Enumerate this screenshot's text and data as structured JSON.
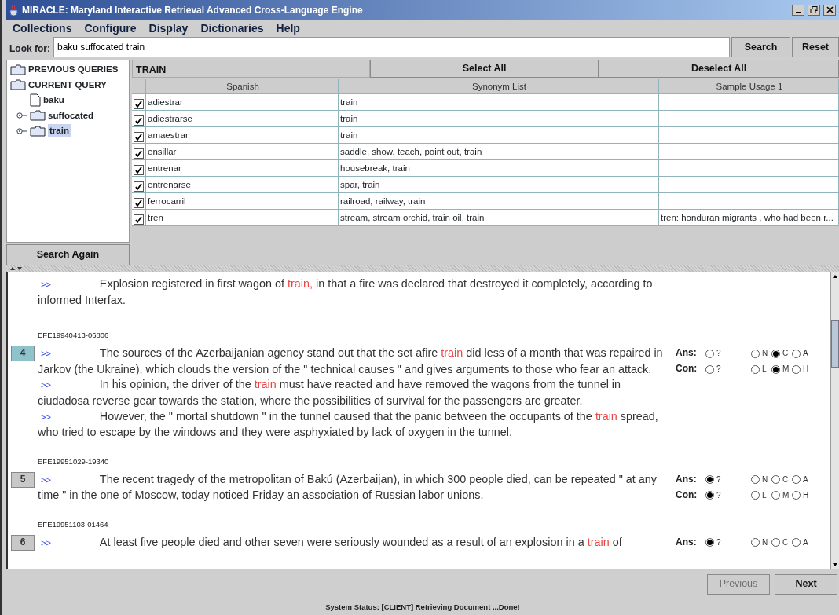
{
  "window": {
    "title": "MIRACLE: Maryland Interactive Retrieval Advanced Cross-Language Engine"
  },
  "menu": [
    "Collections",
    "Configure",
    "Display",
    "Dictionaries",
    "Help"
  ],
  "search": {
    "label": "Look for:",
    "value": "baku suffocated train",
    "buttons": [
      "Search",
      "Reset"
    ]
  },
  "tree": {
    "items": [
      {
        "label": "PREVIOUS QUERIES",
        "kind": "folder",
        "selected": false
      },
      {
        "label": "CURRENT QUERY",
        "kind": "folder",
        "selected": false,
        "children": [
          {
            "label": "baku",
            "kind": "file",
            "selected": false
          },
          {
            "label": "suffocated",
            "kind": "folder",
            "expandable": true,
            "selected": false
          },
          {
            "label": "train",
            "kind": "folder",
            "expandable": true,
            "selected": true
          }
        ]
      }
    ],
    "button": "Search Again"
  },
  "term_panel": {
    "term": "TRAIN",
    "buttons": [
      "Select All",
      "Deselect All"
    ],
    "columns": [
      "Spanish",
      "Synonym List",
      "Sample Usage 1"
    ],
    "rows": [
      {
        "checked": true,
        "spanish": "adiestrar",
        "synonyms": "train"
      },
      {
        "checked": true,
        "spanish": "adiestrarse",
        "synonyms": "train"
      },
      {
        "checked": true,
        "spanish": "amaestrar",
        "synonyms": "train"
      },
      {
        "checked": true,
        "spanish": "ensillar",
        "synonyms": "saddle, show, teach, point out, train"
      },
      {
        "checked": true,
        "spanish": "entrenar",
        "synonyms": "housebreak, train"
      },
      {
        "checked": true,
        "spanish": "entrenarse",
        "synonyms": "spar, train"
      },
      {
        "checked": true,
        "spanish": "ferrocarril",
        "synonyms": "railroad, railway, train"
      },
      {
        "checked": true,
        "spanish": "tren",
        "synonyms": "stream, stream orchid, train oil, train",
        "sample": "tren: honduran migrants , who had been r..."
      }
    ]
  },
  "results": {
    "documents": [
      {
        "paragraphs": [
          {
            "marker": ">>",
            "segments": [
              {
                "text": "Explosion registered in first wagon of ",
                "highlight": false
              },
              {
                "text": "train,",
                "highlight": true
              },
              {
                "text": " in that a fire was declared that destroyed it completely, according to informed Interfax.",
                "highlight": false
              }
            ]
          }
        ]
      },
      {
        "id": "EFE19940413-06806",
        "number": {
          "label": "4",
          "selected": true
        },
        "paragraphs": [
          {
            "marker": ">>",
            "segments": [
              {
                "text": "The sources of the Azerbaijanian agency stand out that the set afire ",
                "highlight": false
              },
              {
                "text": "train",
                "highlight": true
              },
              {
                "text": " did less of a month that was repaired in Jarkov (the Ukraine), which clouds the version of the \" technical causes \" and gives arguments to those who fear an attack.",
                "highlight": false
              }
            ]
          },
          {
            "marker": ">>",
            "segments": [
              {
                "text": "In his opinion, the driver of the ",
                "highlight": false
              },
              {
                "text": "train",
                "highlight": true
              },
              {
                "text": " must have reacted and have removed the wagons from the tunnel in ciudadosa reverse gear towards the station, where the possibilities of survival for the passengers are greater.",
                "highlight": false
              }
            ]
          },
          {
            "marker": ">>",
            "segments": [
              {
                "text": "However, the \" mortal shutdown \" in the tunnel caused that the panic between the occupants of the ",
                "highlight": false
              },
              {
                "text": "train",
                "highlight": true
              },
              {
                "text": " spread, who tried to escape by the windows and they were asphyxiated by lack of oxygen in the tunnel.",
                "highlight": false
              }
            ]
          }
        ],
        "ratings": [
          {
            "label": "Ans:",
            "options": [
              {
                "label": "?",
                "selected": false
              },
              {
                "label": "N",
                "selected": false
              },
              {
                "label": "C",
                "selected": true
              },
              {
                "label": "A",
                "selected": false
              }
            ]
          },
          {
            "label": "Con:",
            "options": [
              {
                "label": "?",
                "selected": false
              },
              {
                "label": "L",
                "selected": false
              },
              {
                "label": "M",
                "selected": true
              },
              {
                "label": "H",
                "selected": false
              }
            ]
          }
        ]
      },
      {
        "id": "EFE19951029-19340",
        "number": {
          "label": "5",
          "selected": false
        },
        "paragraphs": [
          {
            "marker": ">>",
            "segments": [
              {
                "text": "The recent tragedy of the metropolitan of Bakú (Azerbaijan), in which 300 people died, can be repeated \" at any time \" in the one of Moscow, today noticed Friday an association of Russian labor unions.",
                "highlight": false
              }
            ]
          }
        ],
        "ratings": [
          {
            "label": "Ans:",
            "options": [
              {
                "label": "?",
                "selected": true
              },
              {
                "label": "N",
                "selected": false
              },
              {
                "label": "C",
                "selected": false
              },
              {
                "label": "A",
                "selected": false
              }
            ]
          },
          {
            "label": "Con:",
            "options": [
              {
                "label": "?",
                "selected": true
              },
              {
                "label": "L",
                "selected": false
              },
              {
                "label": "M",
                "selected": false
              },
              {
                "label": "H",
                "selected": false
              }
            ]
          }
        ]
      },
      {
        "id": "EFE19951103-01464",
        "number": {
          "label": "6",
          "selected": false
        },
        "paragraphs": [
          {
            "marker": ">>",
            "segments": [
              {
                "text": "At least five people died and other seven were seriously wounded as a result of an explosion in a ",
                "highlight": false
              },
              {
                "text": "train",
                "highlight": true
              },
              {
                "text": " of",
                "highlight": false
              }
            ]
          }
        ],
        "ratings": [
          {
            "label": "Ans:",
            "options": [
              {
                "label": "?",
                "selected": true
              },
              {
                "label": "N",
                "selected": false
              },
              {
                "label": "C",
                "selected": false
              },
              {
                "label": "A",
                "selected": false
              }
            ]
          }
        ]
      }
    ]
  },
  "navigation": [
    {
      "label": "Previous",
      "disabled": true
    },
    {
      "label": "Next",
      "disabled": false
    }
  ],
  "status_bar": "System Status: [CLIENT] Retrieving Document ...Done!"
}
